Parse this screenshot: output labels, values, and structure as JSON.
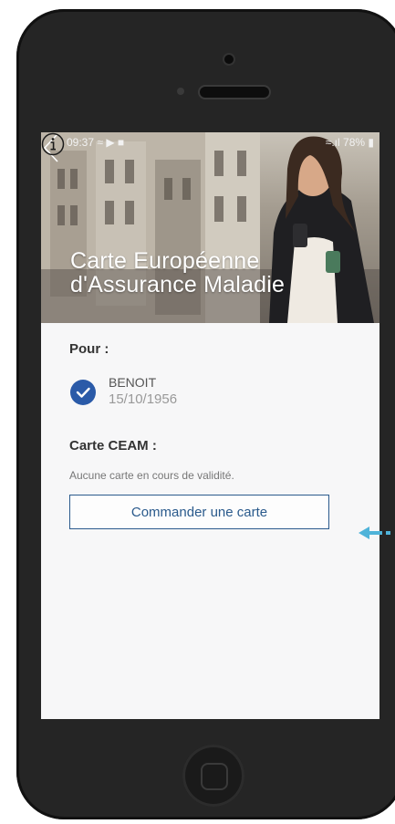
{
  "status_bar": {
    "time": "09:37",
    "right": "78%"
  },
  "hero": {
    "title_line1": "Carte Européenne",
    "title_line2": "d'Assurance Maladie"
  },
  "for_section": {
    "label": "Pour :",
    "beneficiary_name": "BENOIT",
    "beneficiary_birthdate": "15/10/1956"
  },
  "card_section": {
    "label": "Carte CEAM :",
    "status_text": "Aucune carte en cours de validité.",
    "order_button_label": "Commander une carte"
  },
  "colors": {
    "accent": "#2a5aa8",
    "button_border": "#2a5a8c",
    "arrow": "#4fb3d9"
  },
  "icons": [
    "back-chevron-icon",
    "info-icon",
    "check-icon",
    "wifi-icon",
    "signal-icon",
    "battery-icon",
    "arrow-left-icon"
  ]
}
